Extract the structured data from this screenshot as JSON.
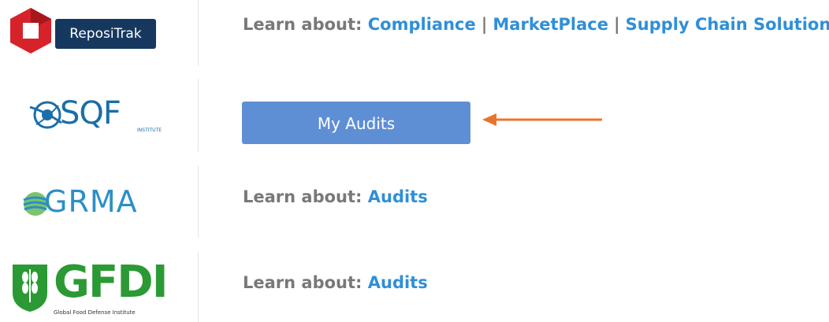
{
  "rows": [
    {
      "logo": {
        "name": "repositrak-logo",
        "text": "ReposiTrak",
        "colors": {
          "hex": "#d6232a",
          "badge": "#17385e"
        }
      },
      "learn_prefix": "Learn about:",
      "links": [
        "Compliance",
        "MarketPlace",
        "Supply Chain Solutions"
      ],
      "separator": "|"
    },
    {
      "logo": {
        "name": "sqf-logo",
        "text": "SQF",
        "subtext": "INSTITUTE",
        "color": "#1b6ea8"
      },
      "button": {
        "label": "My Audits",
        "color": "#5e8fd5"
      },
      "annotation": {
        "icon": "arrow-left-icon",
        "color": "#e8742c"
      }
    },
    {
      "logo": {
        "name": "grma-logo",
        "text": "GRMA",
        "color": "#2b8fc6"
      },
      "learn_prefix": "Learn about:",
      "links": [
        "Audits"
      ]
    },
    {
      "logo": {
        "name": "gfdi-logo",
        "text": "GFDI",
        "subtext": "Global Food Defense Institute",
        "color": "#2b9a35"
      },
      "learn_prefix": "Learn about:",
      "links": [
        "Audits"
      ]
    }
  ]
}
